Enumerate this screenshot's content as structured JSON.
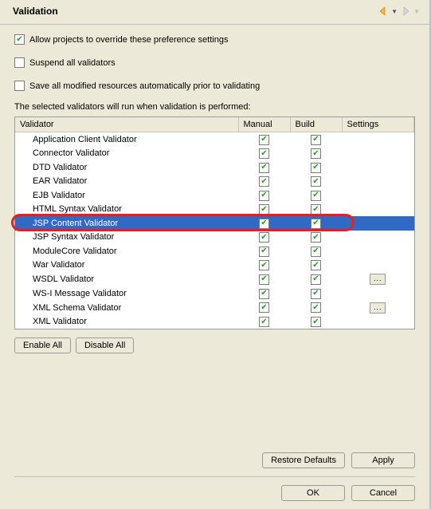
{
  "header": {
    "title": "Validation"
  },
  "options": {
    "allow_override": {
      "label": "Allow projects to override these preference settings",
      "checked": true
    },
    "suspend_all": {
      "label": "Suspend all validators",
      "checked": false
    },
    "save_modified": {
      "label": "Save all modified resources automatically prior to validating",
      "checked": false
    }
  },
  "section_label": "The selected validators will run when validation is performed:",
  "columns": {
    "validator": "Validator",
    "manual": "Manual",
    "build": "Build",
    "settings": "Settings"
  },
  "validators": [
    {
      "name": "Application Client Validator",
      "manual": true,
      "build": true,
      "settings": false,
      "selected": false
    },
    {
      "name": "Connector Validator",
      "manual": true,
      "build": true,
      "settings": false,
      "selected": false
    },
    {
      "name": "DTD Validator",
      "manual": true,
      "build": true,
      "settings": false,
      "selected": false
    },
    {
      "name": "EAR Validator",
      "manual": true,
      "build": true,
      "settings": false,
      "selected": false
    },
    {
      "name": "EJB Validator",
      "manual": true,
      "build": true,
      "settings": false,
      "selected": false
    },
    {
      "name": "HTML Syntax Validator",
      "manual": true,
      "build": true,
      "settings": false,
      "selected": false
    },
    {
      "name": "JSP Content Validator",
      "manual": true,
      "build": true,
      "settings": false,
      "selected": true
    },
    {
      "name": "JSP Syntax Validator",
      "manual": true,
      "build": true,
      "settings": false,
      "selected": false
    },
    {
      "name": "ModuleCore Validator",
      "manual": true,
      "build": true,
      "settings": false,
      "selected": false
    },
    {
      "name": "War Validator",
      "manual": true,
      "build": true,
      "settings": false,
      "selected": false
    },
    {
      "name": "WSDL Validator",
      "manual": true,
      "build": true,
      "settings": true,
      "selected": false
    },
    {
      "name": "WS-I Message Validator",
      "manual": true,
      "build": true,
      "settings": false,
      "selected": false
    },
    {
      "name": "XML Schema Validator",
      "manual": true,
      "build": true,
      "settings": true,
      "selected": false
    },
    {
      "name": "XML Validator",
      "manual": true,
      "build": true,
      "settings": false,
      "selected": false
    }
  ],
  "buttons": {
    "enable_all": "Enable All",
    "disable_all": "Disable All",
    "restore_defaults": "Restore Defaults",
    "apply": "Apply",
    "ok": "OK",
    "cancel": "Cancel",
    "settings_label": "..."
  }
}
